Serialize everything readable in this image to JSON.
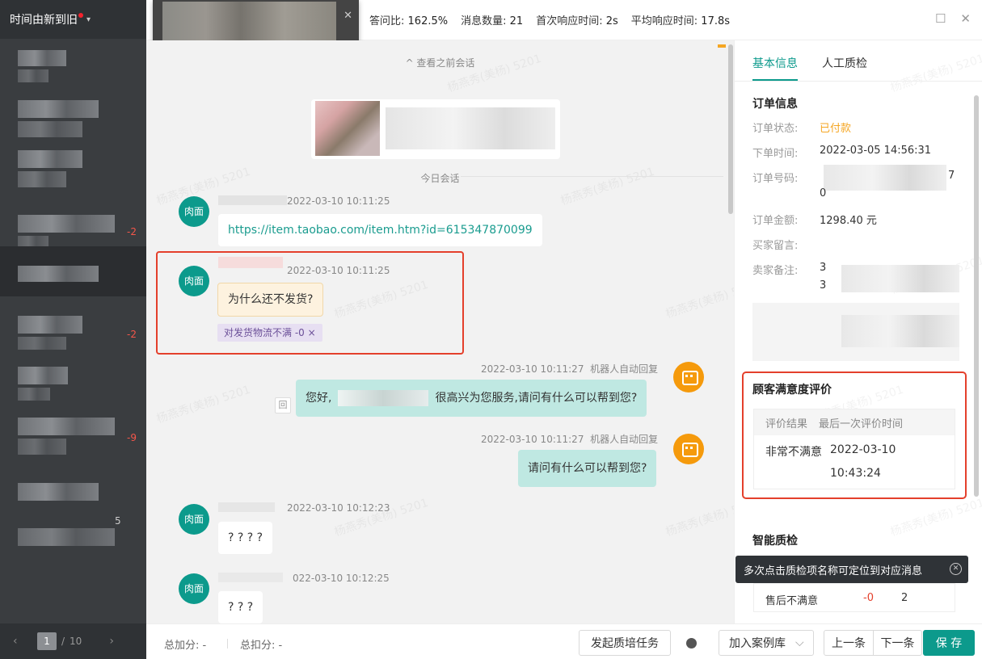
{
  "sidebar": {
    "sort_label": "时间由新到旧",
    "items": [
      {
        "badge": ""
      },
      {
        "badge": ""
      },
      {
        "badge": ""
      },
      {
        "badge": "-2"
      },
      {
        "badge": ""
      },
      {
        "badge": "-2"
      },
      {
        "badge": ""
      },
      {
        "badge": "-9"
      },
      {
        "badge": "5"
      }
    ],
    "pager": {
      "current": "1",
      "total": "10"
    }
  },
  "topbar": {
    "reply_ratio_label": "答问比:",
    "reply_ratio": "162.5%",
    "msg_count_label": "消息数量:",
    "msg_count": "21",
    "first_resp_label": "首次响应时间:",
    "first_resp": "2s",
    "avg_resp_label": "平均响应时间:",
    "avg_resp": "17.8s"
  },
  "chat": {
    "view_previous": "^ 查看之前会话",
    "today_divider": "今日会话",
    "customer_avatar": "肉面",
    "messages": [
      {
        "time": "2022-03-10 10:11:25",
        "text": "https://item.taobao.com/item.htm?id=615347870099"
      },
      {
        "time": "2022-03-10 10:11:25",
        "text": "为什么还不发货?",
        "tag": "对发货物流不满 -0 ×"
      },
      {
        "time": "2022-03-10 10:11:27",
        "sender": "机器人自动回复",
        "text_before": "您好,",
        "text_after": "很高兴为您服务,请问有什么可以帮到您?"
      },
      {
        "time": "2022-03-10 10:11:27",
        "sender": "机器人自动回复",
        "text": "请问有什么可以帮到您?"
      },
      {
        "time": "2022-03-10 10:12:23",
        "text": "? ? ? ?"
      },
      {
        "time": "022-03-10 10:12:25",
        "text": "? ? ?"
      }
    ],
    "msg_icon": "回"
  },
  "right_panel": {
    "tabs": [
      "基本信息",
      "人工质检"
    ],
    "order": {
      "title": "订单信息",
      "status_label": "订单状态:",
      "status": "已付款",
      "time_label": "下单时间:",
      "time": "2022-03-05 14:56:31",
      "no_label": "订单号码:",
      "no_tail1": "7",
      "no_tail2": "0",
      "amount_label": "订单金额:",
      "amount": "1298.40 元",
      "buyer_note_label": "买家留言:",
      "seller_note_label": "卖家备注:",
      "seller_note_head1": "3",
      "seller_note_head2": "3"
    },
    "satisfaction": {
      "title": "顾客满意度评价",
      "col_result": "评价结果",
      "col_time": "最后一次评价时间",
      "result": "非常不满意",
      "date": "2022-03-10",
      "time": "10:43:24"
    },
    "smart_qc": {
      "title": "智能质检",
      "tooltip": "多次点击质检项名称可定位到对应消息",
      "row_name": "售后不满意",
      "row_score": "-0",
      "row_count": "2"
    }
  },
  "bottom": {
    "total_add_label": "总加分:",
    "total_add": "-",
    "total_sub_label": "总扣分:",
    "total_sub": "-",
    "start_training": "发起质培任务",
    "add_case": "加入案例库",
    "prev": "上一条",
    "next": "下一条",
    "save": "保 存"
  },
  "colors": {
    "accent": "#0c9a8c",
    "warning": "#f5a623",
    "danger": "#e4402c"
  }
}
